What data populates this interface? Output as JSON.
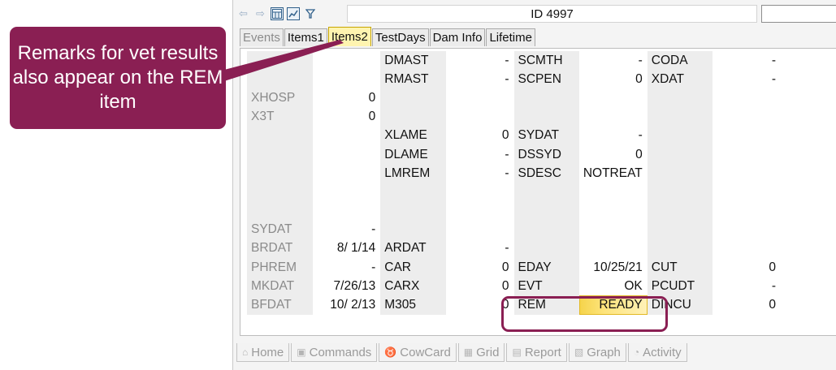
{
  "window": {
    "title": "ID 4997",
    "search_value": ""
  },
  "toolbar": {
    "icons": [
      "back-arrow-icon",
      "forward-arrow-icon",
      "calendar-icon",
      "chart-icon",
      "filter-icon"
    ]
  },
  "tabs": [
    {
      "label": "Events",
      "state": "inactive"
    },
    {
      "label": "Items1",
      "state": "normal"
    },
    {
      "label": "Items2",
      "state": "active"
    },
    {
      "label": "TestDays",
      "state": "normal"
    },
    {
      "label": "Dam Info",
      "state": "normal"
    },
    {
      "label": "Lifetime",
      "state": "normal"
    }
  ],
  "grid_rows": [
    [
      "",
      "",
      "DMAST",
      "-",
      "SCMTH",
      "-",
      "CODA",
      "-"
    ],
    [
      "",
      "",
      "RMAST",
      "-",
      "SCPEN",
      "0",
      "XDAT",
      "-"
    ],
    [
      "XHOSP",
      "0",
      "",
      "",
      "",
      "",
      "",
      ""
    ],
    [
      "X3T",
      "0",
      "",
      "",
      "",
      "",
      "",
      ""
    ],
    [
      "",
      "",
      "XLAME",
      "0",
      "SYDAT",
      "-",
      "",
      ""
    ],
    [
      "",
      "",
      "DLAME",
      "-",
      "DSSYD",
      "0",
      "",
      ""
    ],
    [
      "",
      "",
      "LMREM",
      "-",
      "SDESC",
      "NOTREAT",
      "",
      ""
    ],
    [
      "",
      "",
      "",
      "",
      "",
      "",
      "",
      ""
    ],
    [
      "",
      "",
      "",
      "",
      "",
      "",
      "",
      ""
    ],
    [
      "SYDAT",
      "-",
      "",
      "",
      "",
      "",
      "",
      ""
    ],
    [
      "BRDAT",
      "8/ 1/14",
      "ARDAT",
      "-",
      "",
      "",
      "",
      ""
    ],
    [
      "PHREM",
      "-",
      "CAR",
      "0",
      "EDAY",
      "10/25/21",
      "CUT",
      "0"
    ],
    [
      "MKDAT",
      "7/26/13",
      "CARX",
      "0",
      "EVT",
      "OK",
      "PCUDT",
      "-"
    ],
    [
      "BFDAT",
      "10/ 2/13",
      "M305",
      "0",
      "REM",
      "READY",
      "DINCU",
      "0"
    ]
  ],
  "bottom_tabs": [
    {
      "label": "Home",
      "icon": "home-icon"
    },
    {
      "label": "Commands",
      "icon": "commands-icon"
    },
    {
      "label": "CowCard",
      "icon": "cowcard-icon"
    },
    {
      "label": "Grid",
      "icon": "grid-icon"
    },
    {
      "label": "Report",
      "icon": "report-icon"
    },
    {
      "label": "Graph",
      "icon": "graph-icon"
    },
    {
      "label": "Activity",
      "icon": "activity-icon"
    }
  ],
  "callout": {
    "text": "Remarks for vet results also appear on the REM item"
  },
  "colors": {
    "callout": "#8a1f53",
    "active_tab": "#fff4b0",
    "highlight": "#f5d34a"
  }
}
